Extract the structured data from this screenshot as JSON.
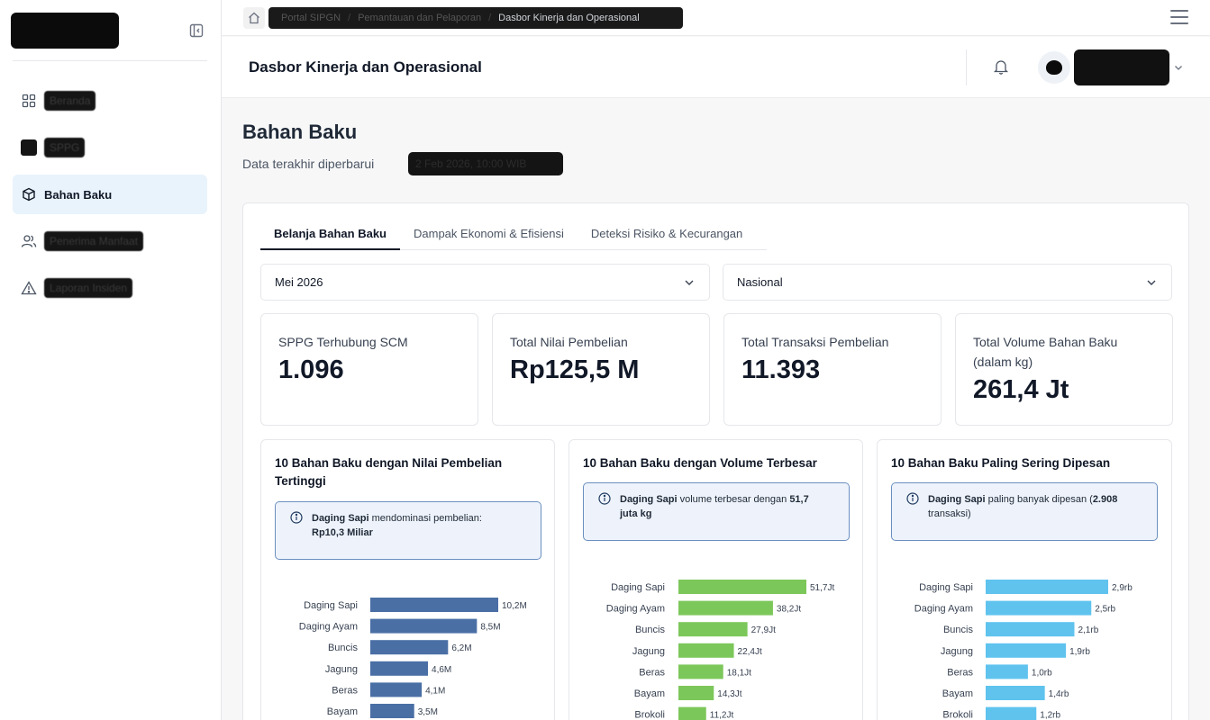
{
  "sidebar": {
    "items": [
      {
        "label": "Beranda",
        "icon": "grid-icon",
        "active": false,
        "redacted": true
      },
      {
        "label": "SPPG",
        "icon": "fork-icon",
        "active": false,
        "redacted": true
      },
      {
        "label": "Bahan Baku",
        "icon": "box-icon",
        "active": true,
        "redacted": false
      },
      {
        "label": "Penerima Manfaat",
        "icon": "users-icon",
        "active": false,
        "redacted": true
      },
      {
        "label": "Laporan Insiden",
        "icon": "alert-triangle-icon",
        "active": false,
        "redacted": true
      }
    ]
  },
  "breadcrumb": {
    "items": [
      "Portal SIPGN",
      "Pemantauan dan Pelaporan",
      "Dasbor Kinerja dan Operasional"
    ]
  },
  "header": {
    "title": "Dasbor Kinerja dan Operasional"
  },
  "page": {
    "title": "Bahan Baku",
    "updated_label": "Data terakhir diperbarui",
    "updated_value": "2 Feb 2026, 10:00 WIB"
  },
  "tabs": [
    {
      "label": "Belanja Bahan Baku",
      "active": true
    },
    {
      "label": "Dampak Ekonomi & Efisiensi",
      "active": false
    },
    {
      "label": "Deteksi Risiko & Kecurangan",
      "active": false
    }
  ],
  "filters": {
    "period": "Mei 2026",
    "region": "Nasional"
  },
  "kpis": [
    {
      "label": "SPPG Terhubung SCM",
      "value": "1.096"
    },
    {
      "label": "Total Nilai Pembelian",
      "value": "Rp125,5 M"
    },
    {
      "label": "Total Transaksi Pembelian",
      "value": "11.393"
    },
    {
      "label": "Total Volume Bahan Baku (dalam kg)",
      "value": "261,4 Jt"
    }
  ],
  "charts_text": [
    {
      "title_line1": "10 Bahan Baku dengan Nilai Pembelian",
      "title_line2": "Tertinggi",
      "insight_bold": "Daging Sapi",
      "insight_text": " mendominasi pembelian:",
      "insight_bold2": "Rp10,3 Miliar",
      "insight_text2": ""
    },
    {
      "title_line1": "10 Bahan Baku dengan Volume Terbesar",
      "title_line2": "",
      "insight_bold": "Daging Sapi",
      "insight_text": " volume terbesar dengan ",
      "insight_bold2": "51,7",
      "insight_text2": "juta kg"
    },
    {
      "title_line1": "10 Bahan Baku Paling Sering Dipesan",
      "title_line2": "",
      "insight_bold": "Daging Sapi",
      "insight_text": " paling banyak dipesan (",
      "insight_bold2": "2.908",
      "insight_text2": "transaksi)"
    }
  ],
  "chart_data": [
    {
      "type": "bar",
      "orientation": "horizontal",
      "title": "10 Bahan Baku dengan Nilai Pembelian Tertinggi",
      "categories": [
        "Daging Sapi",
        "Daging Ayam",
        "Buncis",
        "Jagung",
        "Beras",
        "Bayam"
      ],
      "values": [
        10.2,
        8.5,
        6.2,
        4.6,
        4.1,
        3.5
      ],
      "labels": [
        "10,2M",
        "8,5M",
        "6,2M",
        "4,6M",
        "4,1M",
        "3,5M"
      ],
      "max": 10.2,
      "color": "#4a6fa5"
    },
    {
      "type": "bar",
      "orientation": "horizontal",
      "title": "10 Bahan Baku dengan Volume Terbesar",
      "categories": [
        "Daging Sapi",
        "Daging Ayam",
        "Buncis",
        "Jagung",
        "Beras",
        "Bayam",
        "Brokoli"
      ],
      "values": [
        51.7,
        38.2,
        27.9,
        22.4,
        18.1,
        14.3,
        11.2
      ],
      "labels": [
        "51,7Jt",
        "38,2Jt",
        "27,9Jt",
        "22,4Jt",
        "18,1Jt",
        "14,3Jt",
        "11,2Jt"
      ],
      "max": 51.7,
      "color": "#7cc75a"
    },
    {
      "type": "bar",
      "orientation": "horizontal",
      "title": "10 Bahan Baku Paling Sering Dipesan",
      "categories": [
        "Daging Sapi",
        "Daging Ayam",
        "Buncis",
        "Jagung",
        "Beras",
        "Bayam",
        "Brokoli"
      ],
      "values": [
        2.9,
        2.5,
        2.1,
        1.9,
        1.0,
        1.4,
        1.2
      ],
      "labels": [
        "2,9rb",
        "2,5rb",
        "2,1rb",
        "1,9rb",
        "1,0rb",
        "1,4rb",
        "1,2rb"
      ],
      "max": 2.9,
      "color": "#5fc3ee"
    }
  ],
  "colors": {
    "active_nav_bg": "#e8f3fc",
    "insight_border": "#6b8fbf",
    "insight_bg": "#eef3fb"
  }
}
